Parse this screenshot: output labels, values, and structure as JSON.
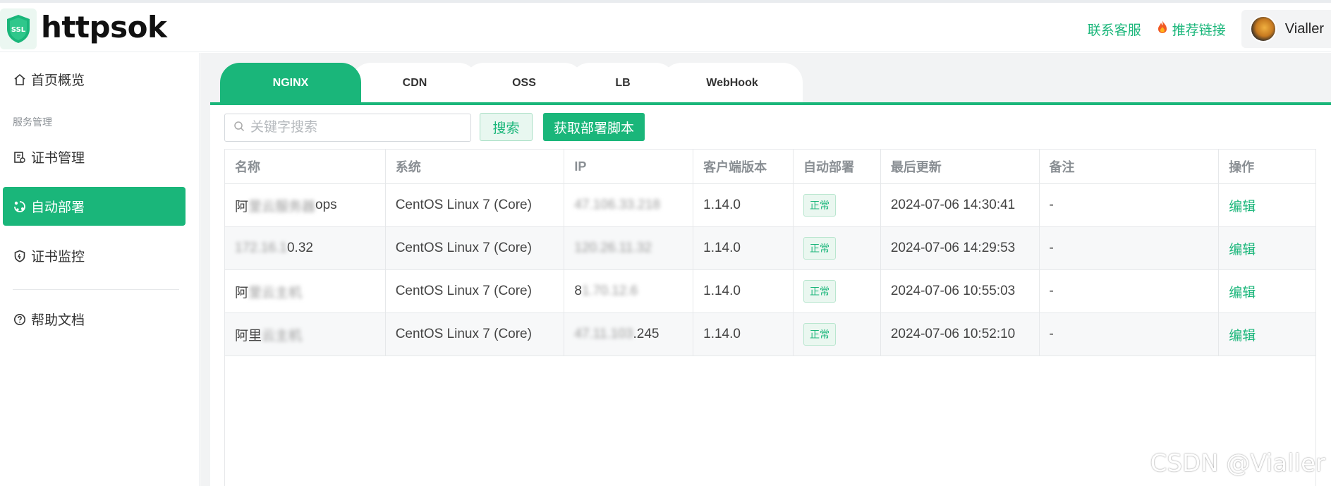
{
  "brand": {
    "logo_badge": "SSL",
    "name": "httpsok"
  },
  "header": {
    "contact_label": "联系客服",
    "referral_label": "推荐链接",
    "username": "Vialler"
  },
  "sidebar": {
    "items": [
      {
        "label": "首页概览",
        "icon": "home-icon"
      },
      {
        "label": "证书管理",
        "icon": "certificate-icon"
      },
      {
        "label": "自动部署",
        "icon": "deploy-icon"
      },
      {
        "label": "证书监控",
        "icon": "shield-icon"
      },
      {
        "label": "帮助文档",
        "icon": "help-icon"
      }
    ],
    "group_label": "服务管理",
    "active_index": 2
  },
  "tabs": {
    "items": [
      "NGINX",
      "CDN",
      "OSS",
      "LB",
      "WebHook"
    ],
    "active": "NGINX"
  },
  "toolbar": {
    "search_placeholder": "关键字搜索",
    "search_value": "",
    "search_button": "搜索",
    "script_button": "获取部署脚本"
  },
  "table": {
    "columns": [
      "名称",
      "系统",
      "IP",
      "客户端版本",
      "自动部署",
      "最后更新",
      "备注",
      "操作"
    ],
    "rows": [
      {
        "name_pre": "阿",
        "name_blur": "里云服务器",
        "name_post": "ops",
        "system": "CentOS Linux 7 (Core)",
        "ip_pre": "",
        "ip_blur": "47.10",
        "ip_post": "6.33.218",
        "version": "1.14.0",
        "status": "正常",
        "updated": "2024-07-06 14:30:41",
        "remark": "-",
        "action": "编辑"
      },
      {
        "name_pre": "",
        "name_blur": "172.16.1",
        "name_post": "0.32",
        "system": "CentOS Linux 7 (Core)",
        "ip_pre": "",
        "ip_blur": "120.26.11.32",
        "ip_post": "",
        "version": "1.14.0",
        "status": "正常",
        "updated": "2024-07-06 14:29:53",
        "remark": "-",
        "action": "编辑"
      },
      {
        "name_pre": "阿",
        "name_blur": "里云主机",
        "name_post": "",
        "system": "CentOS Linux 7 (Core)",
        "ip_pre": "8",
        "ip_blur": "1.70.12.6",
        "ip_post": "",
        "version": "1.14.0",
        "status": "正常",
        "updated": "2024-07-06 10:55:03",
        "remark": "-",
        "action": "编辑"
      },
      {
        "name_pre": "阿里",
        "name_blur": "云主机",
        "name_post": "",
        "system": "CentOS Linux 7 (Core)",
        "ip_pre": "",
        "ip_blur": "47.11.103",
        "ip_post": ".245",
        "version": "1.14.0",
        "status": "正常",
        "updated": "2024-07-06 10:52:10",
        "remark": "-",
        "action": "编辑"
      }
    ]
  },
  "watermark": "CSDN @Vialler",
  "colors": {
    "accent": "#1ab67a",
    "bg_main": "#f2f3f4"
  }
}
